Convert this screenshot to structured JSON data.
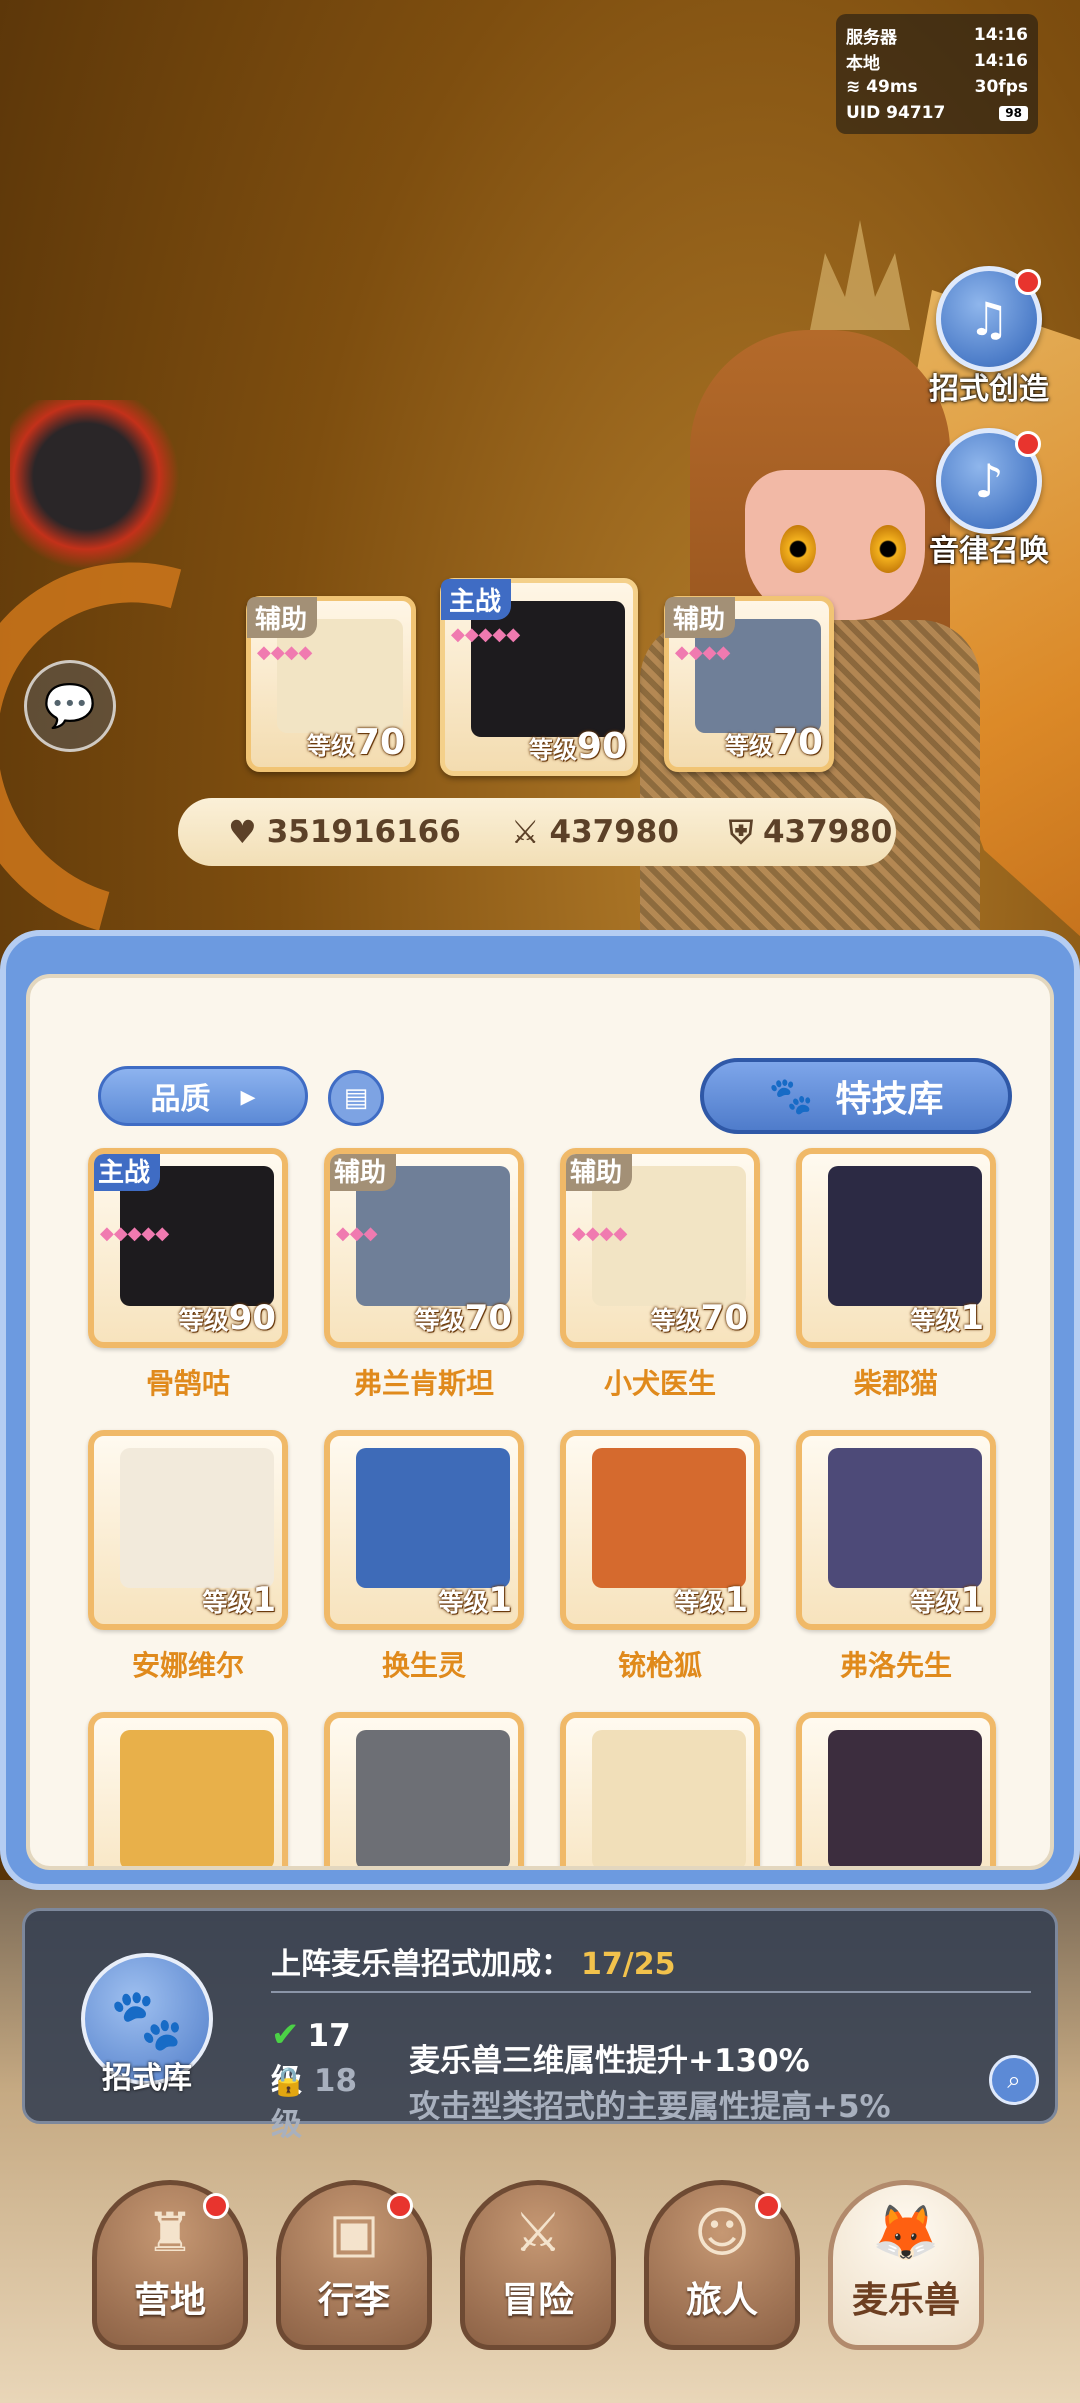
{
  "status": {
    "server_label": "服务器",
    "server_time": "14:16",
    "local_label": "本地",
    "local_time": "14:16",
    "ping": "49ms",
    "fps": "30fps",
    "uid": "UID 94717",
    "battery": "98"
  },
  "side_buttons": {
    "skill_create": "招式创造",
    "melody_summon": "音律召唤"
  },
  "team": [
    {
      "tag": "辅助",
      "level_label": "等级",
      "level": "70",
      "color": "#f2e4c4"
    },
    {
      "tag": "主战",
      "level_label": "等级",
      "level": "90",
      "color": "#1d1b1e"
    },
    {
      "tag": "辅助",
      "level_label": "等级",
      "level": "70",
      "color": "#6f7f98"
    }
  ],
  "stats": {
    "hp": "351916166",
    "attack": "437980",
    "defense": "437980"
  },
  "panel": {
    "quality_label": "品质",
    "skill_lib_label": "特技库"
  },
  "roster": [
    {
      "name": "骨鹄咕",
      "tag": "主战",
      "level_label": "等级",
      "level": "90",
      "color": "#1d1b1e"
    },
    {
      "name": "弗兰肯斯坦",
      "tag": "辅助",
      "level_label": "等级",
      "level": "70",
      "color": "#6f7f98"
    },
    {
      "name": "小犬医生",
      "tag": "辅助",
      "level_label": "等级",
      "level": "70",
      "color": "#f2e4c4"
    },
    {
      "name": "柴郡猫",
      "tag": "",
      "level_label": "等级",
      "level": "1",
      "color": "#2c2a44"
    },
    {
      "name": "安娜维尔",
      "tag": "",
      "level_label": "等级",
      "level": "1",
      "color": "#f2eadb"
    },
    {
      "name": "换生灵",
      "tag": "",
      "level_label": "等级",
      "level": "1",
      "color": "#3e6bb8"
    },
    {
      "name": "铳枪狐",
      "tag": "",
      "level_label": "等级",
      "level": "1",
      "color": "#d56a2e"
    },
    {
      "name": "弗洛先生",
      "tag": "",
      "level_label": "等级",
      "level": "1",
      "color": "#4d4a78"
    },
    {
      "name": "",
      "tag": "",
      "level_label": "",
      "level": "",
      "color": "#e8b04a"
    },
    {
      "name": "",
      "tag": "",
      "level_label": "",
      "level": "",
      "color": "#6d6f75"
    },
    {
      "name": "",
      "tag": "",
      "level_label": "",
      "level": "",
      "color": "#f1dfb9"
    },
    {
      "name": "",
      "tag": "",
      "level_label": "",
      "level": "",
      "color": "#3c2d3e"
    }
  ],
  "bonus": {
    "badge_label": "招式库",
    "title": "上阵麦乐兽招式加成：",
    "progress": "17/25",
    "lines": [
      {
        "level": "17级",
        "text": "麦乐兽三维属性提升+130%",
        "unlocked": true
      },
      {
        "level": "18级",
        "text": "攻击型类招式的主要属性提高+5%",
        "unlocked": false
      }
    ]
  },
  "nav": [
    {
      "label": "营地",
      "icon": "castle-icon",
      "badge": true,
      "active": false
    },
    {
      "label": "行李",
      "icon": "bag-icon",
      "badge": true,
      "active": false
    },
    {
      "label": "冒险",
      "icon": "swords-icon",
      "badge": false,
      "active": false
    },
    {
      "label": "旅人",
      "icon": "traveler-icon",
      "badge": true,
      "active": false
    },
    {
      "label": "麦乐兽",
      "icon": "fox-icon",
      "badge": false,
      "active": true
    }
  ]
}
